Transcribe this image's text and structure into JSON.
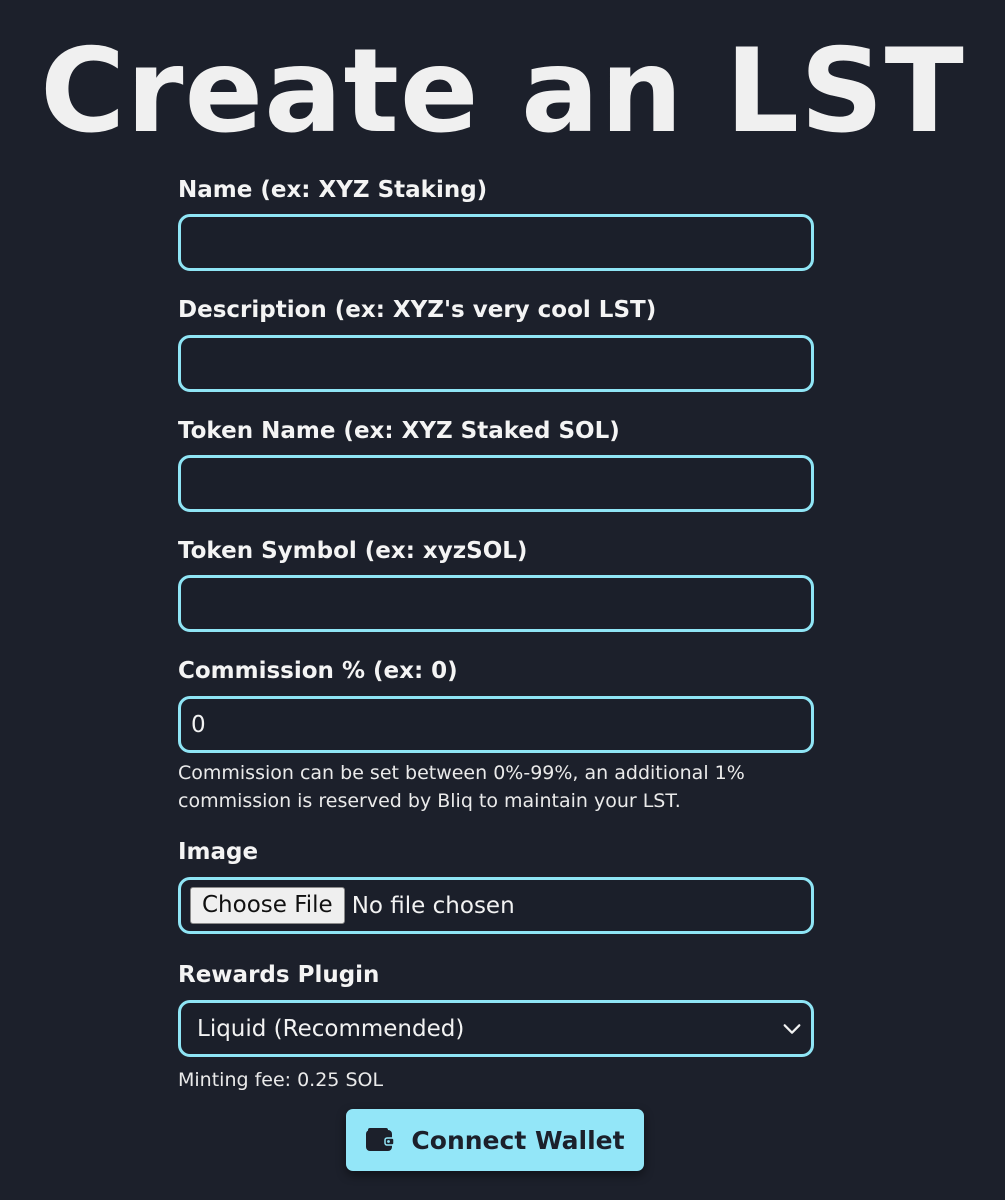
{
  "page": {
    "title": "Create an LST"
  },
  "form": {
    "name": {
      "label": "Name (ex: XYZ Staking)",
      "value": ""
    },
    "description": {
      "label": "Description (ex: XYZ's very cool LST)",
      "value": ""
    },
    "token_name": {
      "label": "Token Name (ex: XYZ Staked SOL)",
      "value": ""
    },
    "token_symbol": {
      "label": "Token Symbol (ex: xyzSOL)",
      "value": ""
    },
    "commission": {
      "label": "Commission % (ex: 0)",
      "value": "0",
      "hint": "Commission can be set between 0%-99%, an additional 1% commission is reserved by Bliq to maintain your LST."
    },
    "image": {
      "label": "Image",
      "button_label": "Choose File",
      "status": "No file chosen"
    },
    "rewards_plugin": {
      "label": "Rewards Plugin",
      "selected": "Liquid (Recommended)",
      "icon": "chevron-down-icon"
    },
    "minting_fee": "Minting fee: 0.25 SOL"
  },
  "connect_wallet": {
    "label": "Connect Wallet",
    "icon": "wallet-icon"
  },
  "colors": {
    "background": "#1c202b",
    "input_border": "#8fe5f5",
    "button_background": "#93e6f8",
    "button_text": "#1c202b",
    "text": "#f2f2f2"
  }
}
